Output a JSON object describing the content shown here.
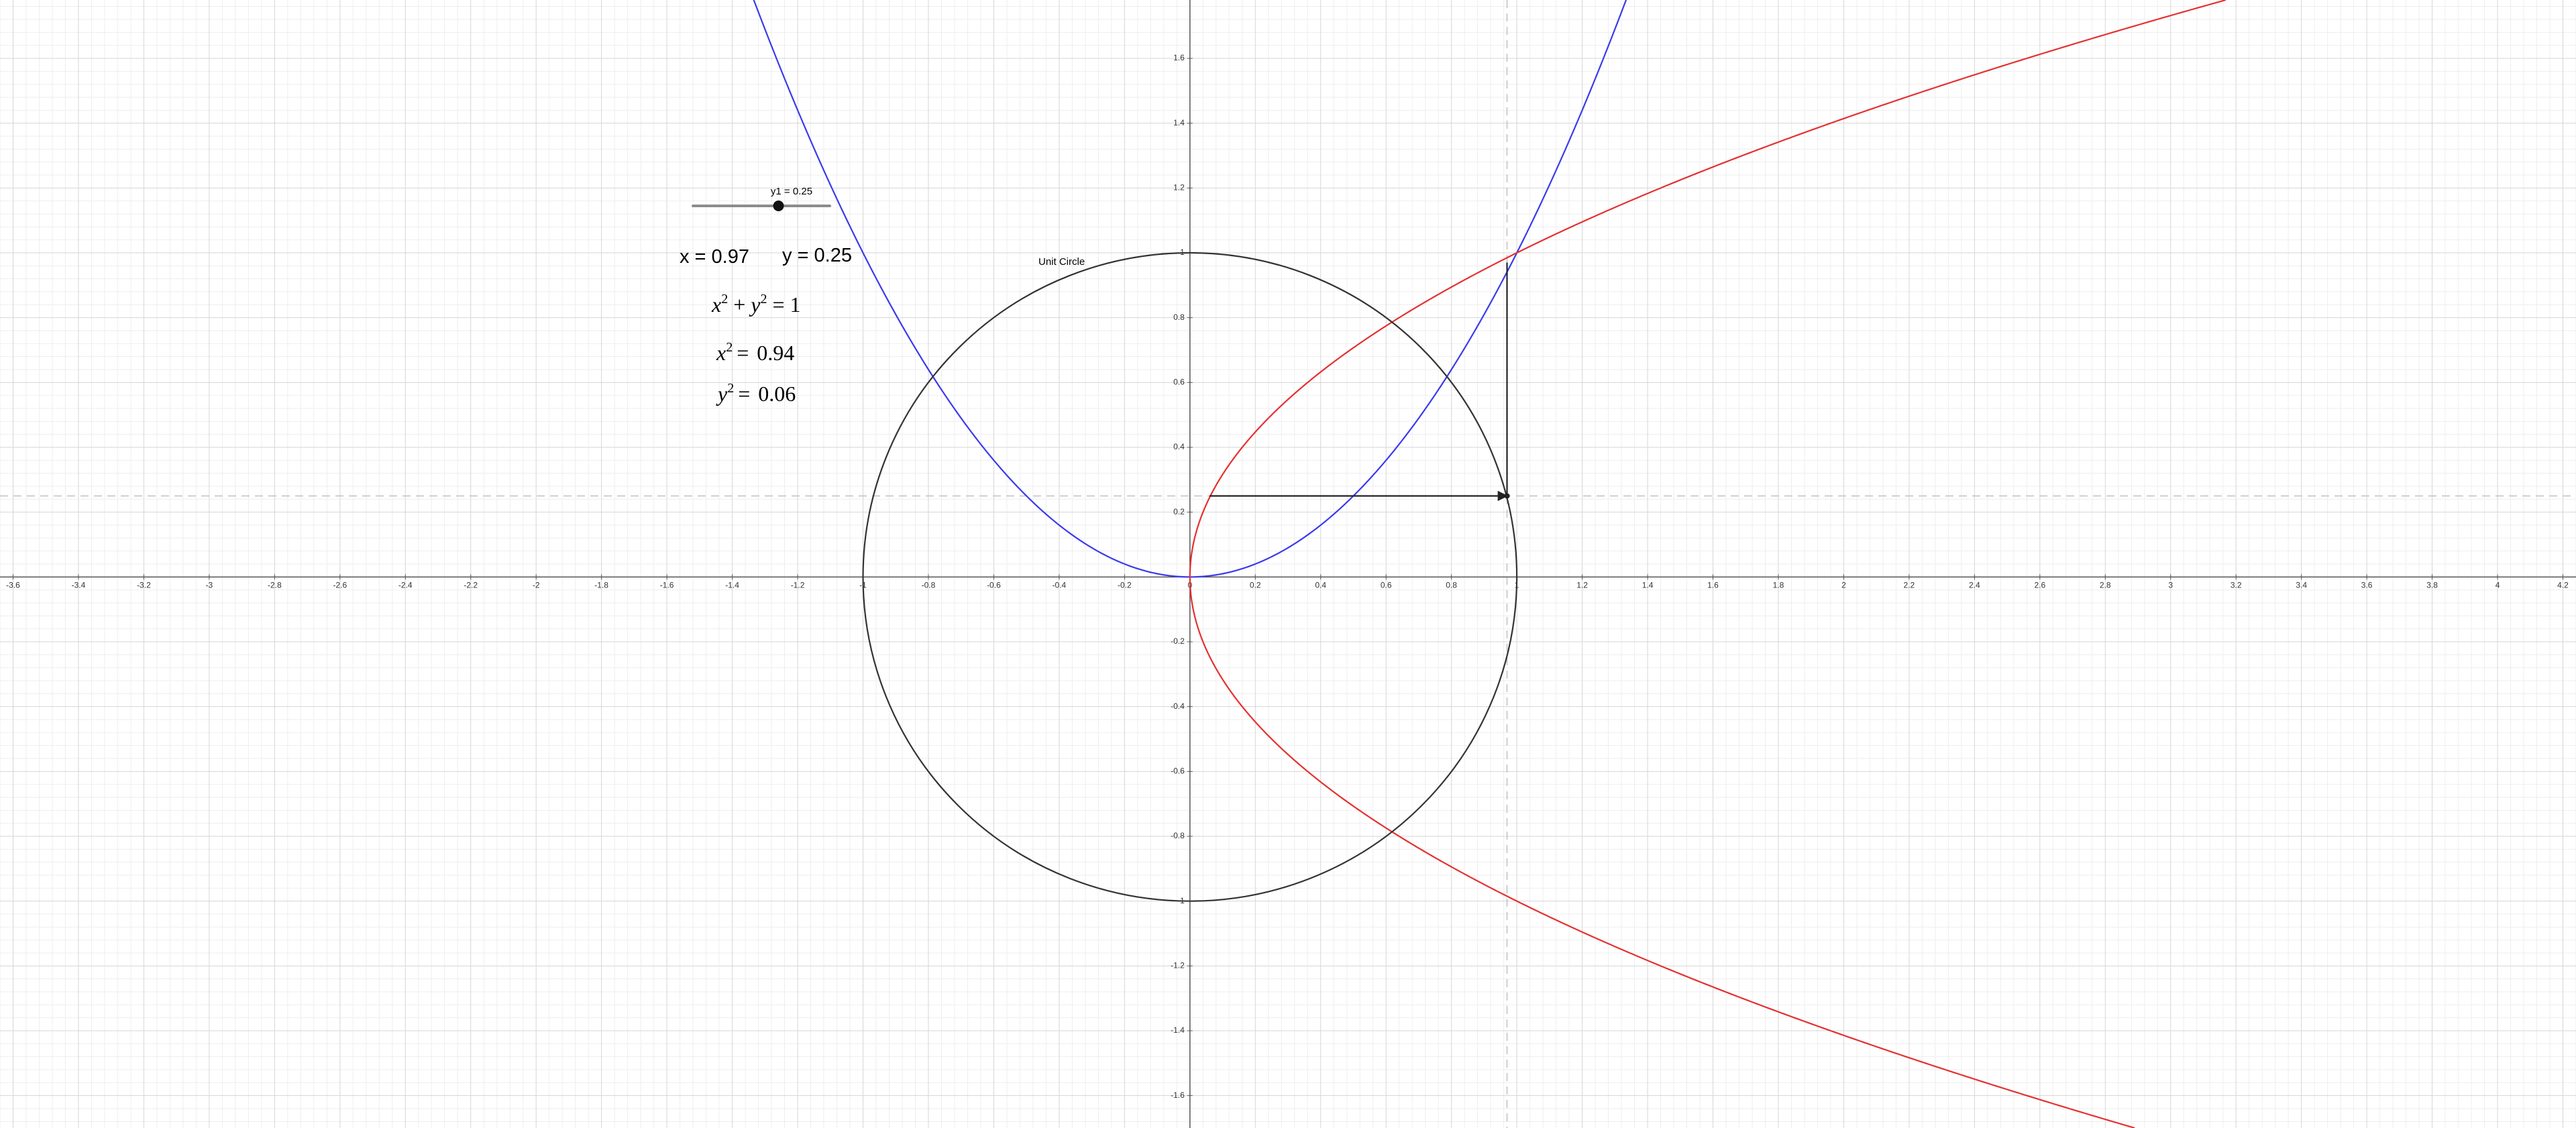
{
  "window": {
    "title": ""
  },
  "colors": {
    "background": "#ffffff",
    "grid_minor": "#eeeeee",
    "grid_major": "#d6d6d6",
    "axis": "#555555",
    "parabola": "#3a3aee",
    "sideways_parabola": "#e53030",
    "circle": "#333333",
    "guide": "#c0c0c0",
    "arrow": "#222222",
    "slider_track": "#8c8c8c",
    "slider_knob": "#111111"
  },
  "slider": {
    "label": "y1 = 0.25",
    "value": 0.25,
    "min": -1,
    "max": 1
  },
  "readout": {
    "x_text": "x = 0.97",
    "y_text": "y = 0.25"
  },
  "equations": {
    "circle": {
      "lhs_a": "x",
      "lhs_b": "y",
      "exp": "2",
      "plus": "+",
      "eq": "=",
      "rhs": "1"
    },
    "x_sq": {
      "var": "x",
      "exp": "2",
      "eq": "=",
      "value": "0.94"
    },
    "y_sq": {
      "var": "y",
      "exp": "2",
      "eq": "=",
      "value": "0.06"
    }
  },
  "circle_label": "Unit Circle",
  "chart_data": {
    "type": "line",
    "xlim": [
      -3.64,
      4.24
    ],
    "ylim": [
      -1.7,
      1.78
    ],
    "grid": true,
    "x_tick_labels": [
      "-3.6",
      "-3.4",
      "-3.2",
      "-3",
      "-2.8",
      "-2.6",
      "-2.4",
      "-2.2",
      "-2",
      "-1.8",
      "-1.6",
      "-1.4",
      "-1.2",
      "-1",
      "-0.8",
      "-0.6",
      "-0.4",
      "-0.2",
      "0",
      "0.2",
      "0.4",
      "0.6",
      "0.8",
      "1",
      "1.2",
      "1.4",
      "1.6",
      "1.8",
      "2",
      "2.2",
      "2.4",
      "2.6",
      "2.8",
      "3",
      "3.2",
      "3.4",
      "3.6",
      "3.8",
      "4",
      "4.2"
    ],
    "y_tick_labels": [
      "1.6",
      "1.4",
      "1.2",
      "1",
      "0.8",
      "0.6",
      "0.4",
      "0.2",
      "-0.2",
      "-0.4",
      "-0.6",
      "-0.8",
      "-1",
      "-1.2",
      "-1.4",
      "-1.6"
    ],
    "curves": [
      {
        "kind": "parabola_y_eq_x2",
        "color_key": "parabola"
      },
      {
        "kind": "parabola_x_eq_y2",
        "color_key": "sideways_parabola"
      },
      {
        "kind": "circle",
        "center": [
          0,
          0
        ],
        "radius": 1,
        "color_key": "circle"
      }
    ],
    "guides": {
      "x": 0.97,
      "y": 0.25
    },
    "vector": {
      "from": [
        0.06,
        0.25
      ],
      "to": [
        0.97,
        0.25
      ]
    },
    "vertical_segment": {
      "x": 0.97,
      "from_y": 0.25,
      "to_y": 0.97
    }
  }
}
